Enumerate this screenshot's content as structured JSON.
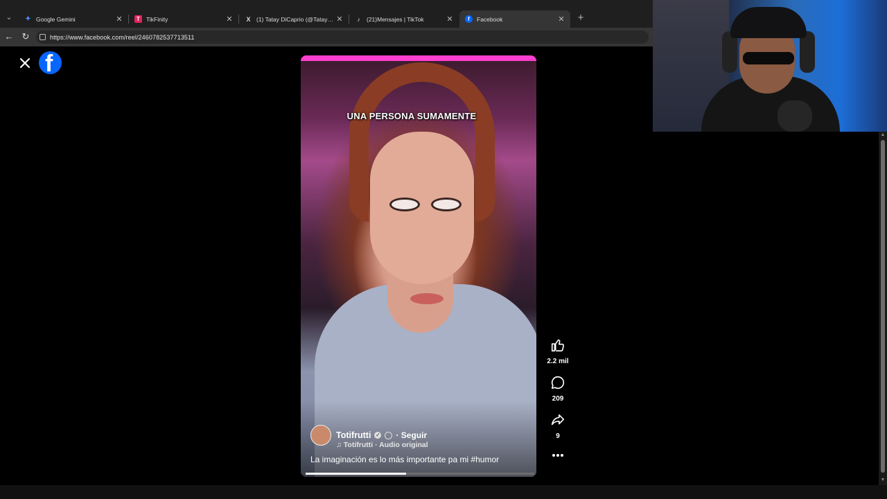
{
  "browser": {
    "tabs": [
      {
        "label": "Google Gemini",
        "favicon_color": "#4f8cf7",
        "favicon_glyph": "✦"
      },
      {
        "label": "TikFinity",
        "favicon_color": "#e0245e",
        "favicon_glyph": "T"
      },
      {
        "label": "(1) Tatay DiCaprio (@Tatay_DiCaprio)",
        "favicon_color": "#1f1f1f",
        "favicon_glyph": "X"
      },
      {
        "label": "(21)Mensajes | TikTok",
        "favicon_color": "#1f1f1f",
        "favicon_glyph": "♪"
      },
      {
        "label": "Facebook",
        "favicon_color": "#0866ff",
        "favicon_glyph": "f",
        "active": true
      }
    ],
    "url": "https://www.facebook.com/reel/2460782537713511"
  },
  "reel": {
    "overlay_text": "UNA PERSONA SUMAMENTE",
    "author": "Totifrutti",
    "follow_label": "· Seguir",
    "audio": "Totifrutti · Audio original",
    "description": "La imaginación es lo más importante pa mi #humor",
    "progress": 0.44,
    "likes": "2.2 mil",
    "comments": "209",
    "shares": "9"
  },
  "colors": {
    "facebook_blue": "#0866ff",
    "tab_bar": "#1f1f1f",
    "active_tab": "#353535"
  }
}
